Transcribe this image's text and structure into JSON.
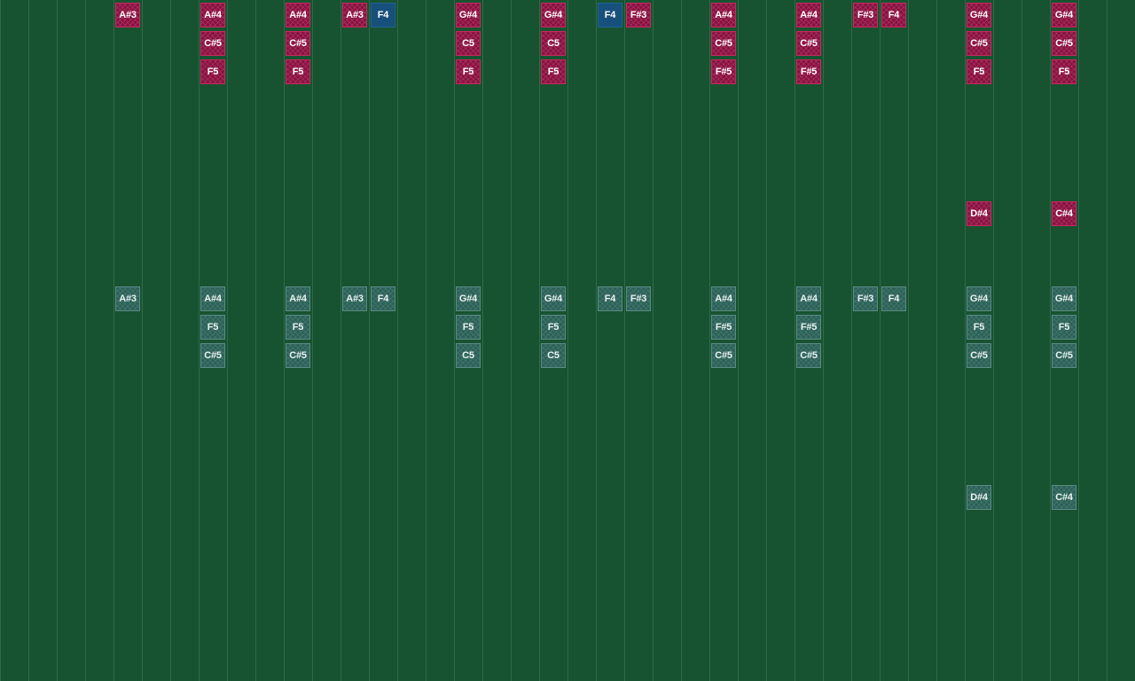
{
  "game": {
    "colors": {
      "background": "#175330",
      "grid_line": "#2f6a4a",
      "falling_note": "#8c1040",
      "active_note": "#17507a",
      "target_note": "#2b6258"
    },
    "columns": 40,
    "falling_notes": [
      {
        "col": 4,
        "row": 0,
        "label": "A#3",
        "kind": "falling"
      },
      {
        "col": 7,
        "row": 0,
        "label": "A#4",
        "kind": "falling"
      },
      {
        "col": 7,
        "row": 1,
        "label": "C#5",
        "kind": "falling"
      },
      {
        "col": 7,
        "row": 2,
        "label": "F5",
        "kind": "falling"
      },
      {
        "col": 10,
        "row": 0,
        "label": "A#4",
        "kind": "falling"
      },
      {
        "col": 10,
        "row": 1,
        "label": "C#5",
        "kind": "falling"
      },
      {
        "col": 10,
        "row": 2,
        "label": "F5",
        "kind": "falling"
      },
      {
        "col": 12,
        "row": 0,
        "label": "A#3",
        "kind": "falling"
      },
      {
        "col": 13,
        "row": 0,
        "label": "F4",
        "kind": "active"
      },
      {
        "col": 16,
        "row": 0,
        "label": "G#4",
        "kind": "falling"
      },
      {
        "col": 16,
        "row": 1,
        "label": "C5",
        "kind": "falling"
      },
      {
        "col": 16,
        "row": 2,
        "label": "F5",
        "kind": "falling"
      },
      {
        "col": 19,
        "row": 0,
        "label": "G#4",
        "kind": "falling"
      },
      {
        "col": 19,
        "row": 1,
        "label": "C5",
        "kind": "falling"
      },
      {
        "col": 19,
        "row": 2,
        "label": "F5",
        "kind": "falling"
      },
      {
        "col": 21,
        "row": 0,
        "label": "F4",
        "kind": "active"
      },
      {
        "col": 22,
        "row": 0,
        "label": "F#3",
        "kind": "falling"
      },
      {
        "col": 25,
        "row": 0,
        "label": "A#4",
        "kind": "falling"
      },
      {
        "col": 25,
        "row": 1,
        "label": "C#5",
        "kind": "falling"
      },
      {
        "col": 25,
        "row": 2,
        "label": "F#5",
        "kind": "falling"
      },
      {
        "col": 28,
        "row": 0,
        "label": "A#4",
        "kind": "falling"
      },
      {
        "col": 28,
        "row": 1,
        "label": "C#5",
        "kind": "falling"
      },
      {
        "col": 28,
        "row": 2,
        "label": "F#5",
        "kind": "falling"
      },
      {
        "col": 30,
        "row": 0,
        "label": "F#3",
        "kind": "falling"
      },
      {
        "col": 31,
        "row": 0,
        "label": "F4",
        "kind": "falling"
      },
      {
        "col": 34,
        "row": 0,
        "label": "G#4",
        "kind": "falling"
      },
      {
        "col": 34,
        "row": 1,
        "label": "C#5",
        "kind": "falling"
      },
      {
        "col": 34,
        "row": 2,
        "label": "F5",
        "kind": "falling"
      },
      {
        "col": 34,
        "row": 7,
        "label": "D#4",
        "kind": "falling"
      },
      {
        "col": 37,
        "row": 0,
        "label": "G#4",
        "kind": "falling"
      },
      {
        "col": 37,
        "row": 1,
        "label": "C#5",
        "kind": "falling"
      },
      {
        "col": 37,
        "row": 2,
        "label": "F5",
        "kind": "falling"
      },
      {
        "col": 37,
        "row": 7,
        "label": "C#4",
        "kind": "falling"
      }
    ],
    "target_notes": [
      {
        "col": 4,
        "row": 10,
        "label": "A#3"
      },
      {
        "col": 7,
        "row": 10,
        "label": "A#4"
      },
      {
        "col": 7,
        "row": 11,
        "label": "F5"
      },
      {
        "col": 7,
        "row": 12,
        "label": "C#5"
      },
      {
        "col": 10,
        "row": 10,
        "label": "A#4"
      },
      {
        "col": 10,
        "row": 11,
        "label": "F5"
      },
      {
        "col": 10,
        "row": 12,
        "label": "C#5"
      },
      {
        "col": 12,
        "row": 10,
        "label": "A#3"
      },
      {
        "col": 13,
        "row": 10,
        "label": "F4"
      },
      {
        "col": 16,
        "row": 10,
        "label": "G#4"
      },
      {
        "col": 16,
        "row": 11,
        "label": "F5"
      },
      {
        "col": 16,
        "row": 12,
        "label": "C5"
      },
      {
        "col": 19,
        "row": 10,
        "label": "G#4"
      },
      {
        "col": 19,
        "row": 11,
        "label": "F5"
      },
      {
        "col": 19,
        "row": 12,
        "label": "C5"
      },
      {
        "col": 21,
        "row": 10,
        "label": "F4"
      },
      {
        "col": 22,
        "row": 10,
        "label": "F#3"
      },
      {
        "col": 25,
        "row": 10,
        "label": "A#4"
      },
      {
        "col": 25,
        "row": 11,
        "label": "F#5"
      },
      {
        "col": 25,
        "row": 12,
        "label": "C#5"
      },
      {
        "col": 28,
        "row": 10,
        "label": "A#4"
      },
      {
        "col": 28,
        "row": 11,
        "label": "F#5"
      },
      {
        "col": 28,
        "row": 12,
        "label": "C#5"
      },
      {
        "col": 30,
        "row": 10,
        "label": "F#3"
      },
      {
        "col": 31,
        "row": 10,
        "label": "F4"
      },
      {
        "col": 34,
        "row": 10,
        "label": "G#4"
      },
      {
        "col": 34,
        "row": 11,
        "label": "F5"
      },
      {
        "col": 34,
        "row": 12,
        "label": "C#5"
      },
      {
        "col": 34,
        "row": 17,
        "label": "D#4"
      },
      {
        "col": 37,
        "row": 10,
        "label": "G#4"
      },
      {
        "col": 37,
        "row": 11,
        "label": "F5"
      },
      {
        "col": 37,
        "row": 12,
        "label": "C#5"
      },
      {
        "col": 37,
        "row": 17,
        "label": "C#4"
      }
    ]
  }
}
